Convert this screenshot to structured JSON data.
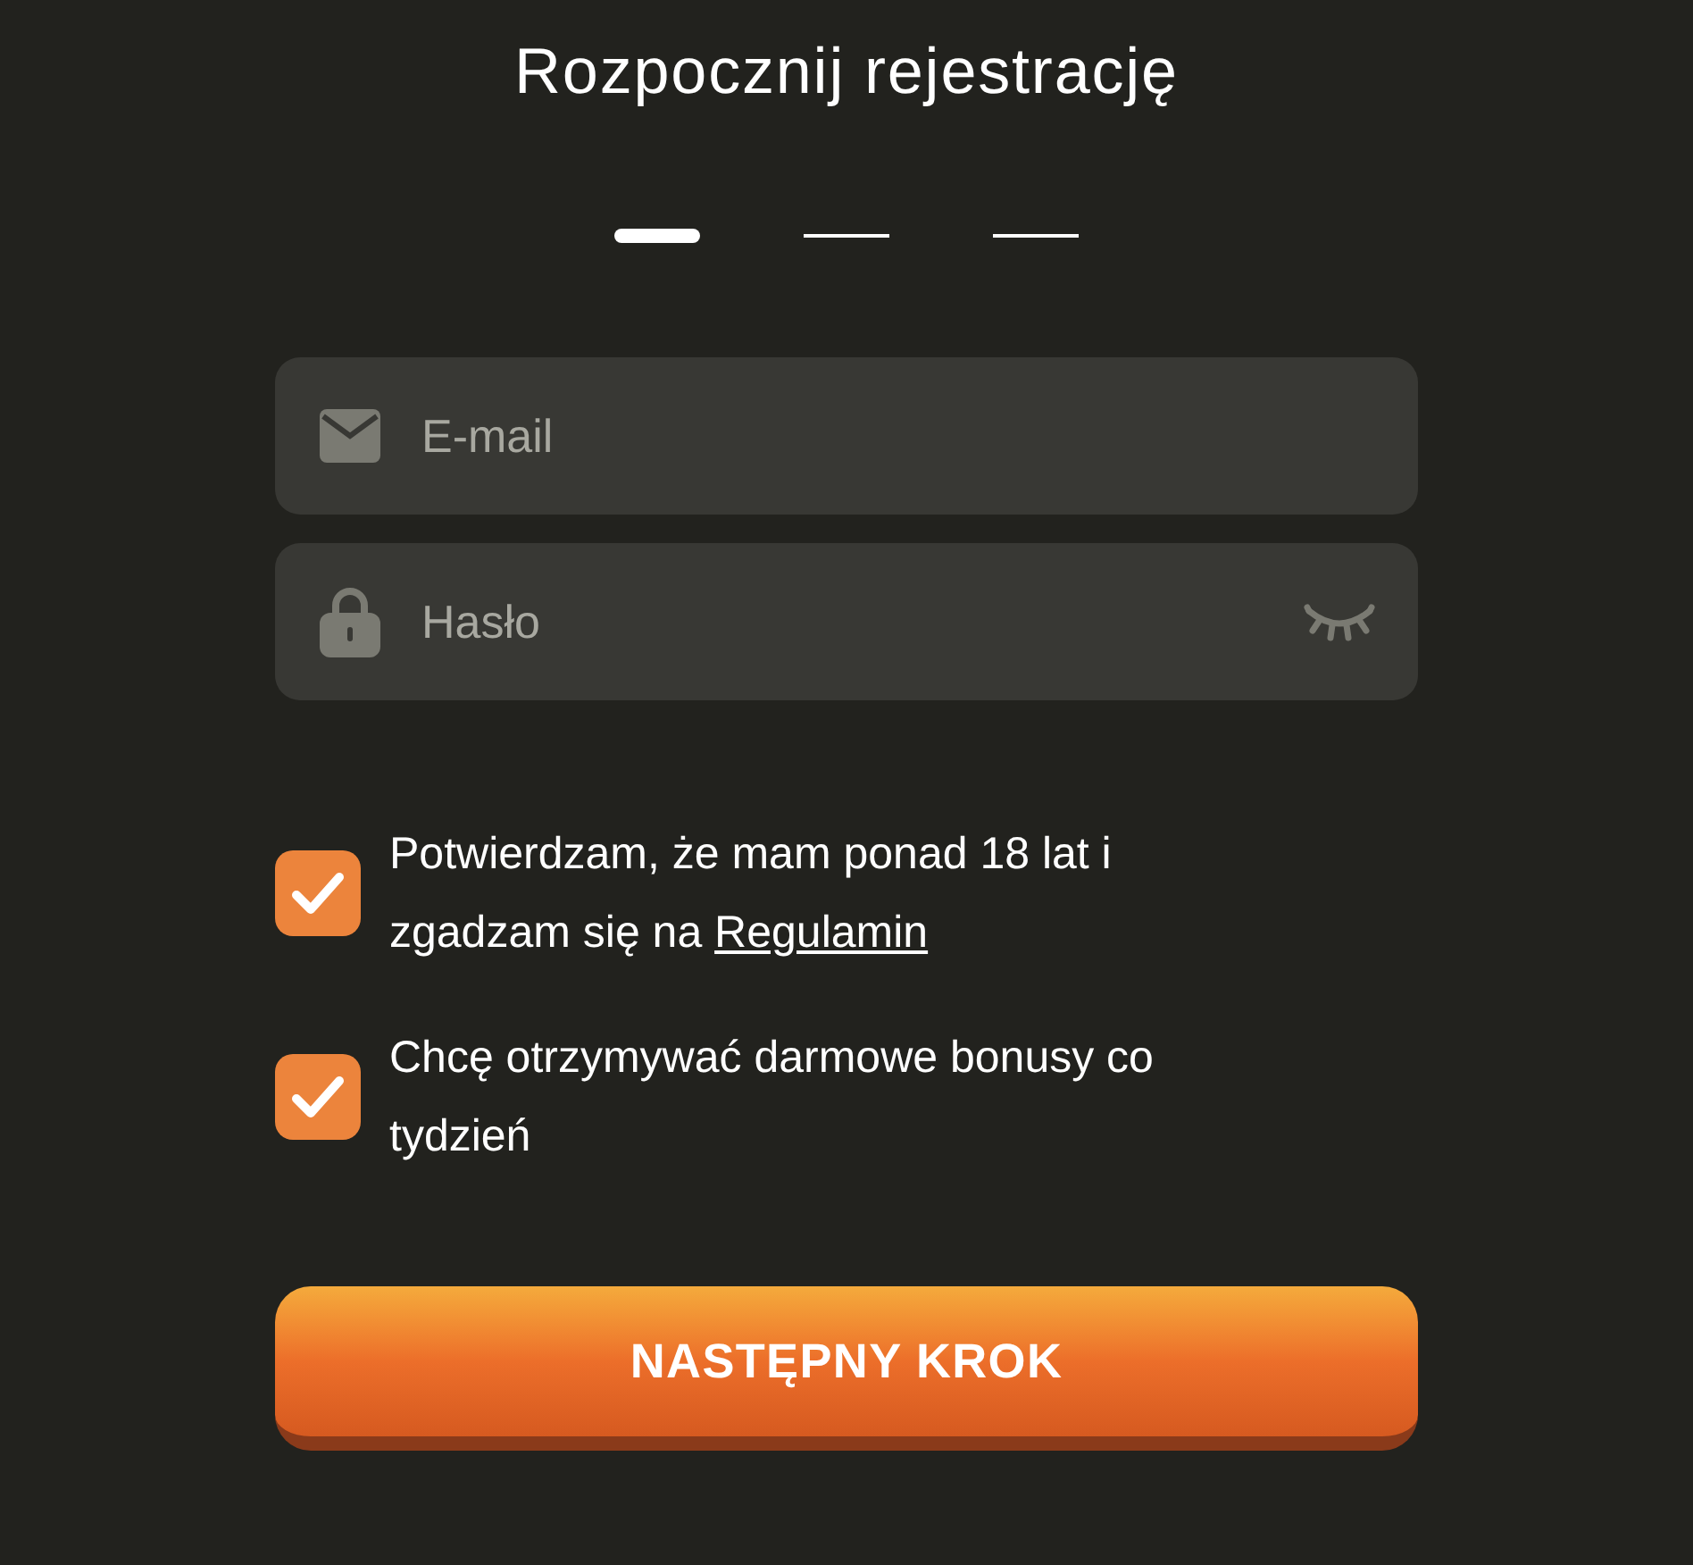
{
  "title": "Rozpocznij rejestrację",
  "steps": [
    {
      "selected": true
    },
    {
      "selected": false
    },
    {
      "selected": false
    }
  ],
  "fields": [
    {
      "kind": "email",
      "placeholder": "E-mail"
    },
    {
      "kind": "password",
      "placeholder": "Hasło"
    }
  ],
  "checkboxes": [
    {
      "checked": true,
      "text": "Potwierdzam, że mam ponad 18 lat i zgadzam się na ",
      "link": "Regulamin"
    },
    {
      "checked": true,
      "text": "Chcę otrzymywać darmowe bonusy co tydzień"
    }
  ],
  "button": "NASTĘPNY KROK"
}
